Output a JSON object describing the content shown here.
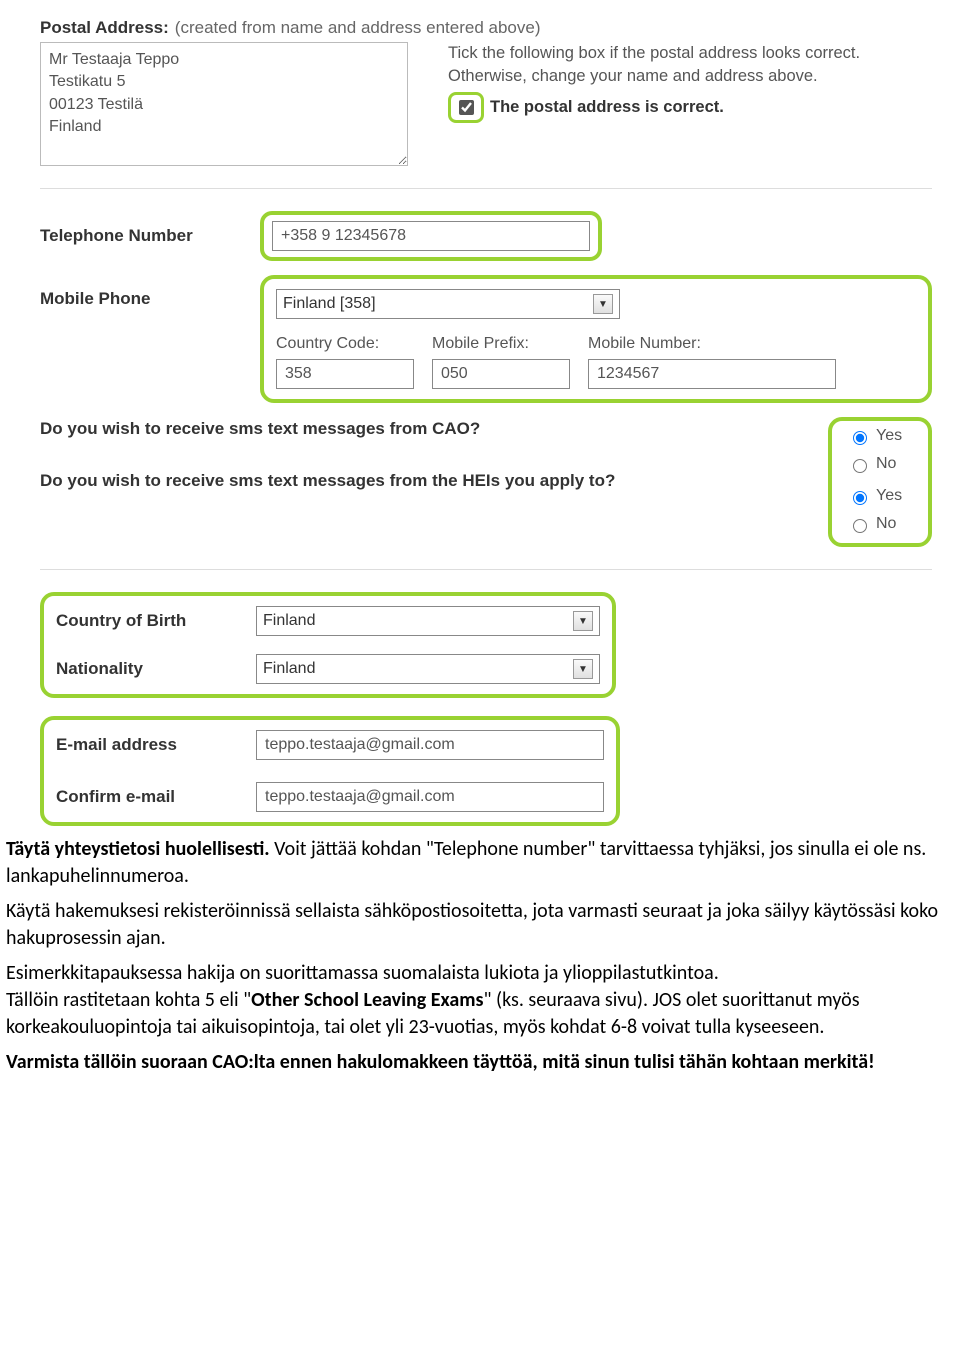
{
  "postal": {
    "label": "Postal Address:",
    "hint": "(created from name and address entered above)",
    "textarea_value": "Mr Testaaja Teppo\nTestikatu 5\n00123 Testilä\nFinland",
    "help1": "Tick the following box if the postal address looks correct.",
    "help2": "Otherwise, change your name and address above.",
    "confirm_label": "The postal address is correct."
  },
  "telephone": {
    "label": "Telephone Number",
    "value": "+358 9 12345678"
  },
  "mobile": {
    "label": "Mobile Phone",
    "country_select": "Finland [358]",
    "cc_label": "Country Code:",
    "prefix_label": "Mobile Prefix:",
    "number_label": "Mobile Number:",
    "cc_value": "358",
    "prefix_value": "050",
    "number_value": "1234567"
  },
  "sms_cao": {
    "question": "Do you wish to receive sms text messages from CAO?",
    "yes": "Yes",
    "no": "No"
  },
  "sms_hei": {
    "question": "Do you wish to receive sms text messages from the HEIs you apply to?",
    "yes": "Yes",
    "no": "No"
  },
  "cob": {
    "label": "Country of Birth",
    "value": "Finland"
  },
  "nationality": {
    "label": "Nationality",
    "value": "Finland"
  },
  "email": {
    "label": "E-mail address",
    "value": "teppo.testaaja@gmail.com"
  },
  "confirm_email": {
    "label": "Confirm e-mail",
    "value": "teppo.testaaja@gmail.com"
  },
  "instructions": {
    "p1a": "Täytä yhteystietosi huolellisesti.",
    "p1b": " Voit jättää kohdan \"Telephone number\" tarvittaessa tyhjäksi, jos sinulla ei ole ns. lankapuhelinnumeroa.",
    "p2": "Käytä hakemuksesi rekisteröinnissä sellaista sähköpostiosoitetta, jota varmasti seuraat ja joka säilyy käytössäsi koko hakuprosessin ajan.",
    "p3a": "Esimerkkitapauksessa hakija on suorittamassa suomalaista lukiota ja ylioppilastutkintoa.",
    "p3b": "Tällöin rastitetaan kohta 5 eli \"",
    "p3c": "Other School Leaving Exams",
    "p3d": "\" (ks. seuraava sivu). JOS olet suorittanut myös korkeakouluopintoja tai aikuisopintoja, tai olet yli 23-vuotias, myös kohdat 6-8 voivat tulla kyseeseen.",
    "p4": "Varmista tällöin suoraan CAO:lta ennen hakulomakkeen täyttöä, mitä sinun tulisi tähän kohtaan merkitä!"
  }
}
